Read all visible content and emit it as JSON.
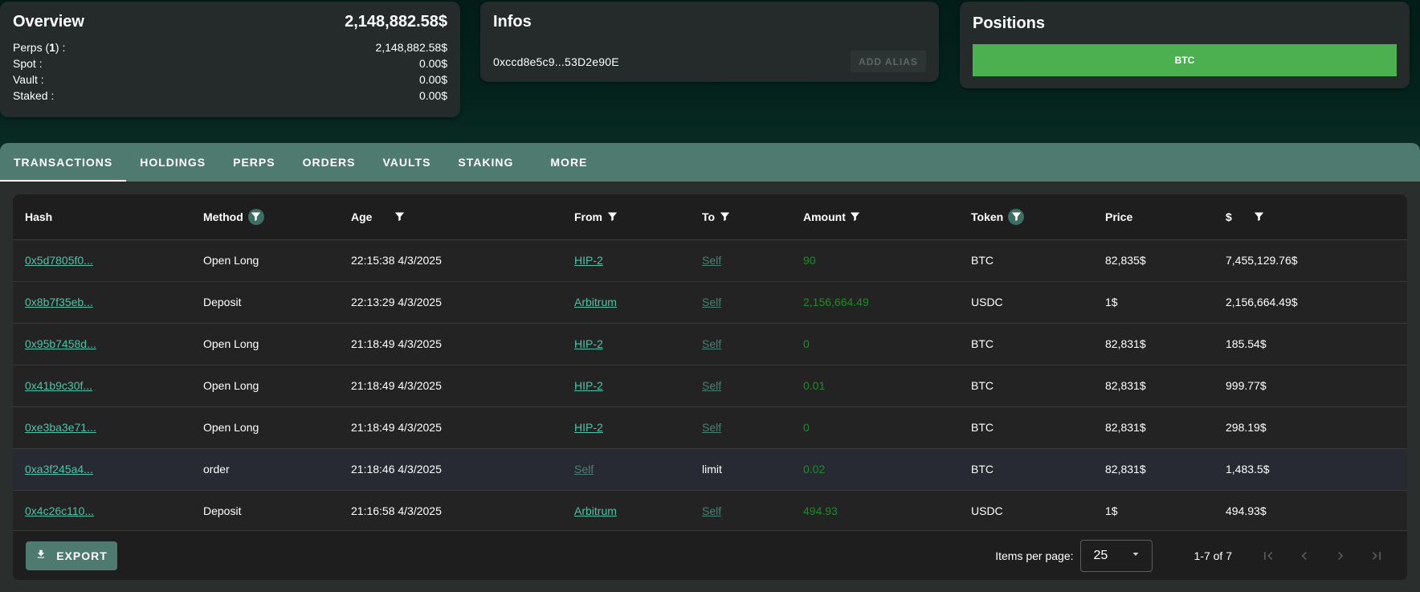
{
  "overview": {
    "title": "Overview",
    "total": "2,148,882.58$",
    "rows": [
      {
        "label_pre": "Perps (",
        "label_bold": "1",
        "label_post": ") :",
        "value": "2,148,882.58$"
      },
      {
        "label_pre": "Spot :",
        "label_bold": "",
        "label_post": "",
        "value": "0.00$"
      },
      {
        "label_pre": "Vault :",
        "label_bold": "",
        "label_post": "",
        "value": "0.00$"
      },
      {
        "label_pre": "Staked :",
        "label_bold": "",
        "label_post": "",
        "value": "0.00$"
      }
    ]
  },
  "infos": {
    "title": "Infos",
    "address": "0xccd8e5c9...53D2e90E",
    "alias_button": "ADD ALIAS"
  },
  "positions": {
    "title": "Positions",
    "items": [
      {
        "label": "BTC",
        "color": "#4caf50"
      }
    ]
  },
  "tabs": [
    {
      "label": "TRANSACTIONS",
      "active": true
    },
    {
      "label": "HOLDINGS"
    },
    {
      "label": "PERPS"
    },
    {
      "label": "ORDERS"
    },
    {
      "label": "VAULTS"
    },
    {
      "label": "STAKING"
    },
    {
      "label": "MORE"
    }
  ],
  "table": {
    "columns": [
      {
        "label": "Hash",
        "filter": "none"
      },
      {
        "label": "Method",
        "filter": "active"
      },
      {
        "label": "Age",
        "filter": "plain"
      },
      {
        "label": "From",
        "filter": "plain"
      },
      {
        "label": "To",
        "filter": "plain"
      },
      {
        "label": "Amount",
        "filter": "plain"
      },
      {
        "label": "Token",
        "filter": "active"
      },
      {
        "label": "Price",
        "filter": "none"
      },
      {
        "label": "$",
        "filter": "plain"
      }
    ],
    "rows": [
      {
        "hash": "0x5d7805f0...",
        "method": "Open Long",
        "age": "22:15:38 4/3/2025",
        "from": "HIP-2",
        "from_style": "link",
        "to": "Self",
        "to_style": "dim",
        "amount": "90",
        "token": "BTC",
        "price": "82,835$",
        "usd": "7,455,129.76$"
      },
      {
        "hash": "0x8b7f35eb...",
        "method": "Deposit",
        "age": "22:13:29 4/3/2025",
        "from": "Arbitrum",
        "from_style": "link",
        "to": "Self",
        "to_style": "dim",
        "amount": "2,156,664.49",
        "token": "USDC",
        "price": "1$",
        "usd": "2,156,664.49$"
      },
      {
        "hash": "0x95b7458d...",
        "method": "Open Long",
        "age": "21:18:49 4/3/2025",
        "from": "HIP-2",
        "from_style": "link",
        "to": "Self",
        "to_style": "dim",
        "amount": "0",
        "token": "BTC",
        "price": "82,831$",
        "usd": "185.54$"
      },
      {
        "hash": "0x41b9c30f...",
        "method": "Open Long",
        "age": "21:18:49 4/3/2025",
        "from": "HIP-2",
        "from_style": "link",
        "to": "Self",
        "to_style": "dim",
        "amount": "0.01",
        "token": "BTC",
        "price": "82,831$",
        "usd": "999.77$"
      },
      {
        "hash": "0xe3ba3e71...",
        "method": "Open Long",
        "age": "21:18:49 4/3/2025",
        "from": "HIP-2",
        "from_style": "link",
        "to": "Self",
        "to_style": "dim",
        "amount": "0",
        "token": "BTC",
        "price": "82,831$",
        "usd": "298.19$"
      },
      {
        "hash": "0xa3f245a4...",
        "method": "order",
        "age": "21:18:46 4/3/2025",
        "from": "Self",
        "from_style": "dim",
        "to": "limit",
        "to_style": "plain",
        "amount": "0.02",
        "token": "BTC",
        "price": "82,831$",
        "usd": "1,483.5$",
        "highlight": true
      },
      {
        "hash": "0x4c26c110...",
        "method": "Deposit",
        "age": "21:16:58 4/3/2025",
        "from": "Arbitrum",
        "from_style": "link",
        "to": "Self",
        "to_style": "dim",
        "amount": "494.93",
        "token": "USDC",
        "price": "1$",
        "usd": "494.93$"
      }
    ]
  },
  "footer": {
    "export_label": "EXPORT",
    "items_per_page_label": "Items per page:",
    "items_per_page": "25",
    "range": "1-7 of 7"
  },
  "colors": {
    "accent": "#4e7a70",
    "link": "#51c2a8",
    "link_dim": "#4b7f74",
    "amount": "#1f8a2a",
    "position_bar": "#4caf50"
  }
}
